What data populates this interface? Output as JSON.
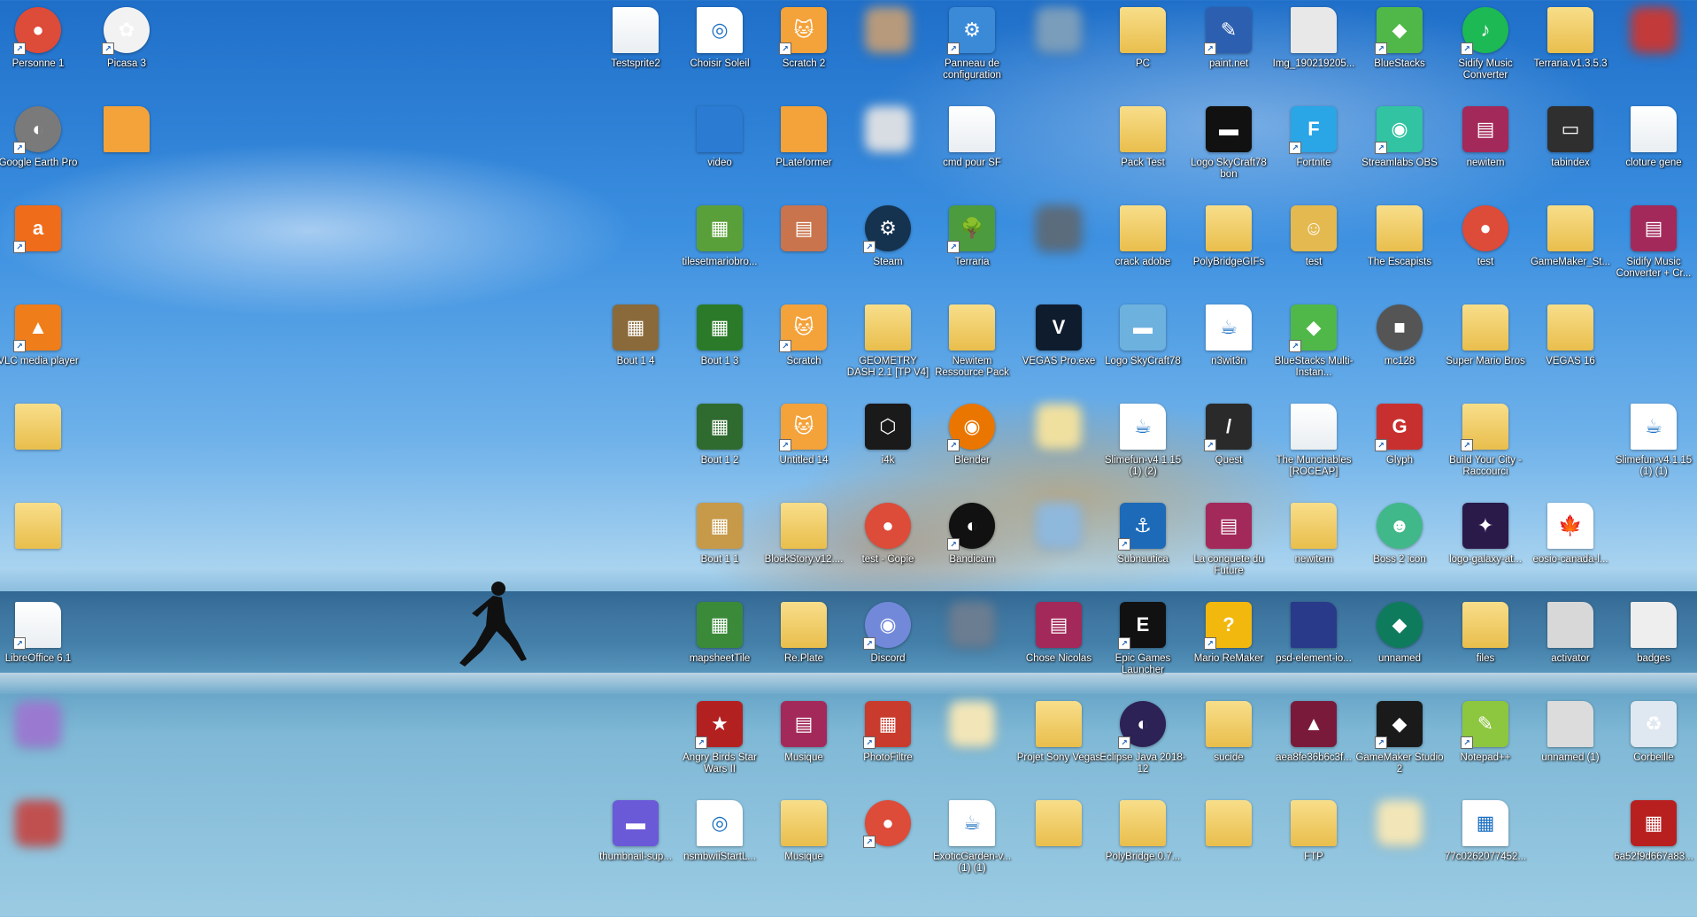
{
  "desktop": {
    "icons": [
      {
        "label": "Personne 1",
        "glyph": "●",
        "bg": "#dd4b39",
        "shape": "round",
        "shortcut": true
      },
      {
        "label": "Picasa 3",
        "glyph": "✿",
        "bg": "#f2f2f2",
        "shape": "round",
        "shortcut": true
      },
      {
        "label": "Testsprite2",
        "glyph": "",
        "bg": "",
        "shape": "file",
        "shortcut": false
      },
      {
        "label": "Choisir Soleil",
        "glyph": "◎",
        "bg": "#ffffff",
        "shape": "file",
        "shortcut": false
      },
      {
        "label": "Scratch 2",
        "glyph": "🐱",
        "bg": "#f4a23a",
        "shape": "",
        "shortcut": true
      },
      {
        "label": "",
        "glyph": "",
        "bg": "#b79a7c",
        "shape": "blur",
        "shortcut": false
      },
      {
        "label": "Panneau de configuration",
        "glyph": "⚙",
        "bg": "#3a8ad8",
        "shape": "",
        "shortcut": true
      },
      {
        "label": "",
        "glyph": "",
        "bg": "#7a9dbb",
        "shape": "blur",
        "shortcut": false
      },
      {
        "label": "PC",
        "glyph": "",
        "bg": "",
        "shape": "folder",
        "shortcut": false
      },
      {
        "label": "paint.net",
        "glyph": "✎",
        "bg": "#2d5fb0",
        "shape": "",
        "shortcut": true
      },
      {
        "label": "Img_190219205...",
        "glyph": "",
        "bg": "#e8e8e8",
        "shape": "file",
        "shortcut": false
      },
      {
        "label": "BlueStacks",
        "glyph": "◆",
        "bg": "#4fb848",
        "shape": "",
        "shortcut": true
      },
      {
        "label": "Sidify Music Converter",
        "glyph": "♪",
        "bg": "#1db954",
        "shape": "round",
        "shortcut": true
      },
      {
        "label": "Terraria.v1.3.5.3",
        "glyph": "",
        "bg": "",
        "shape": "folder",
        "shortcut": false
      },
      {
        "label": "",
        "glyph": "",
        "bg": "#c23a3a",
        "shape": "blur",
        "shortcut": false
      },
      {
        "label": "Google Earth Pro",
        "glyph": "◐",
        "bg": "#7a7a7a",
        "shape": "round",
        "shortcut": true
      },
      {
        "label": "",
        "glyph": "🐱",
        "bg": "#f4a23a",
        "shape": "file",
        "shortcut": false
      },
      {
        "label": "video",
        "glyph": "▶",
        "bg": "#2b7bd3",
        "shape": "file",
        "shortcut": false
      },
      {
        "label": "PLateformer",
        "glyph": "🐱",
        "bg": "#f4a23a",
        "shape": "file",
        "shortcut": false
      },
      {
        "label": "",
        "glyph": "",
        "bg": "#d8dde3",
        "shape": "blur",
        "shortcut": false
      },
      {
        "label": "cmd pour SF",
        "glyph": "",
        "bg": "",
        "shape": "file",
        "shortcut": false
      },
      {
        "label": "Pack Test",
        "glyph": "",
        "bg": "",
        "shape": "folder",
        "shortcut": false
      },
      {
        "label": "Logo SkyCraft78 bon",
        "glyph": "▬",
        "bg": "#111111",
        "shape": "",
        "shortcut": false
      },
      {
        "label": "Fortnite",
        "glyph": "F",
        "bg": "#2aa5e6",
        "shape": "",
        "shortcut": true
      },
      {
        "label": "Streamlabs OBS",
        "glyph": "◉",
        "bg": "#31c3a2",
        "shape": "",
        "shortcut": true
      },
      {
        "label": "newitem",
        "glyph": "▤",
        "bg": "#a3295a",
        "shape": "",
        "shortcut": false
      },
      {
        "label": "tabindex",
        "glyph": "▭",
        "bg": "#2f2f2f",
        "shape": "",
        "shortcut": false
      },
      {
        "label": "cloture gene",
        "glyph": "",
        "bg": "",
        "shape": "file",
        "shortcut": false
      },
      {
        "label": "",
        "glyph": "a",
        "bg": "#ef6c1a",
        "shape": "",
        "shortcut": true
      },
      {
        "label": "tilesetmariobro...",
        "glyph": "▦",
        "bg": "#5aa03a",
        "shape": "",
        "shortcut": false
      },
      {
        "label": "",
        "glyph": "▤",
        "bg": "#c9744d",
        "shape": "",
        "shortcut": false
      },
      {
        "label": "Steam",
        "glyph": "⚙",
        "bg": "#15324f",
        "shape": "round",
        "shortcut": true
      },
      {
        "label": "Terraria",
        "glyph": "🌳",
        "bg": "#4c9b3f",
        "shape": "",
        "shortcut": true
      },
      {
        "label": "",
        "glyph": "",
        "bg": "#5b6c7c",
        "shape": "blur",
        "shortcut": false
      },
      {
        "label": "crack adobe",
        "glyph": "",
        "bg": "",
        "shape": "folder",
        "shortcut": false
      },
      {
        "label": "PolyBridgeGIFs",
        "glyph": "",
        "bg": "",
        "shape": "folder",
        "shortcut": false
      },
      {
        "label": "test",
        "glyph": "☺",
        "bg": "#e4b94f",
        "shape": "",
        "shortcut": false
      },
      {
        "label": "The Escapists",
        "glyph": "",
        "bg": "",
        "shape": "folder",
        "shortcut": false
      },
      {
        "label": "test",
        "glyph": "●",
        "bg": "#dd4b39",
        "shape": "round",
        "shortcut": false
      },
      {
        "label": "GameMaker_St...",
        "glyph": "",
        "bg": "",
        "shape": "folder",
        "shortcut": false
      },
      {
        "label": "Sidify Music Converter + Cr...",
        "glyph": "▤",
        "bg": "#a3295a",
        "shape": "",
        "shortcut": false
      },
      {
        "label": "VLC media player",
        "glyph": "▲",
        "bg": "#ef7d1a",
        "shape": "",
        "shortcut": true
      },
      {
        "label": "Bout 1 4",
        "glyph": "▦",
        "bg": "#8a6a3a",
        "shape": "",
        "shortcut": false
      },
      {
        "label": "Bout 1 3",
        "glyph": "▦",
        "bg": "#2a7a2a",
        "shape": "",
        "shortcut": false
      },
      {
        "label": "Scratch",
        "glyph": "🐱",
        "bg": "#f4a23a",
        "shape": "",
        "shortcut": true
      },
      {
        "label": "GEOMETRY DASH 2.1 [TP V4]",
        "glyph": "",
        "bg": "",
        "shape": "folder",
        "shortcut": false
      },
      {
        "label": "Newitem Ressource Pack",
        "glyph": "",
        "bg": "",
        "shape": "folder",
        "shortcut": false
      },
      {
        "label": "VEGAS Pro.exe",
        "glyph": "V",
        "bg": "#0f1c2e",
        "shape": "",
        "shortcut": false
      },
      {
        "label": "Logo SkyCraft78",
        "glyph": "▬",
        "bg": "#6db2de",
        "shape": "",
        "shortcut": false
      },
      {
        "label": "n3wit3n",
        "glyph": "☕",
        "bg": "#ffffff",
        "shape": "file",
        "shortcut": false
      },
      {
        "label": "BlueStacks Multi-Instan...",
        "glyph": "◆",
        "bg": "#4fb848",
        "shape": "",
        "shortcut": true
      },
      {
        "label": "mc128",
        "glyph": "■",
        "bg": "#555555",
        "shape": "round",
        "shortcut": false
      },
      {
        "label": "Super Mario Bros",
        "glyph": "",
        "bg": "",
        "shape": "folder",
        "shortcut": false
      },
      {
        "label": "VEGAS 16",
        "glyph": "",
        "bg": "",
        "shape": "folder",
        "shortcut": false
      },
      {
        "label": "",
        "glyph": "",
        "bg": "",
        "shape": "folder",
        "shortcut": false
      },
      {
        "label": "Bout 1 2",
        "glyph": "▦",
        "bg": "#2f6a2f",
        "shape": "",
        "shortcut": false
      },
      {
        "label": "Untitled 14",
        "glyph": "🐱",
        "bg": "#f4a23a",
        "shape": "",
        "shortcut": true
      },
      {
        "label": "i4k",
        "glyph": "⬡",
        "bg": "#1a1a1a",
        "shape": "",
        "shortcut": false
      },
      {
        "label": "Blender",
        "glyph": "◉",
        "bg": "#ea7600",
        "shape": "round",
        "shortcut": true
      },
      {
        "label": "",
        "glyph": "",
        "bg": "#f0e0a0",
        "shape": "blur",
        "shortcut": false
      },
      {
        "label": "Slimefun-v4.1.15 (1) (2)",
        "glyph": "☕",
        "bg": "#ffffff",
        "shape": "file",
        "shortcut": false
      },
      {
        "label": "Quest",
        "glyph": "/",
        "bg": "#2a2a2a",
        "shape": "",
        "shortcut": true
      },
      {
        "label": "The Munchables [ROCEAP]",
        "glyph": "",
        "bg": "",
        "shape": "file",
        "shortcut": false
      },
      {
        "label": "Glyph",
        "glyph": "G",
        "bg": "#c8302f",
        "shape": "",
        "shortcut": true
      },
      {
        "label": "Build Your City - Raccourci",
        "glyph": "",
        "bg": "",
        "shape": "folder",
        "shortcut": true
      },
      {
        "label": "Slimefun-v4.1.15 (1) (1)",
        "glyph": "☕",
        "bg": "#ffffff",
        "shape": "file",
        "shortcut": false
      },
      {
        "label": "",
        "glyph": "",
        "bg": "",
        "shape": "folder",
        "shortcut": false
      },
      {
        "label": "Bout 1 1",
        "glyph": "▦",
        "bg": "#c79a4a",
        "shape": "",
        "shortcut": false
      },
      {
        "label": "BlockStory.v12....",
        "glyph": "",
        "bg": "",
        "shape": "folder",
        "shortcut": false
      },
      {
        "label": "test - Copie",
        "glyph": "●",
        "bg": "#dd4b39",
        "shape": "round",
        "shortcut": false
      },
      {
        "label": "Bandicam",
        "glyph": "◐",
        "bg": "#111111",
        "shape": "round",
        "shortcut": true
      },
      {
        "label": "",
        "glyph": "",
        "bg": "#8fb8dd",
        "shape": "blur",
        "shortcut": false
      },
      {
        "label": "Subnautica",
        "glyph": "⚓",
        "bg": "#1c6ab8",
        "shape": "",
        "shortcut": true
      },
      {
        "label": "La conquete du Future",
        "glyph": "▤",
        "bg": "#a3295a",
        "shape": "",
        "shortcut": false
      },
      {
        "label": "newitem",
        "glyph": "",
        "bg": "",
        "shape": "folder",
        "shortcut": false
      },
      {
        "label": "Boss 2 icon",
        "glyph": "☻",
        "bg": "#41b88a",
        "shape": "round",
        "shortcut": false
      },
      {
        "label": "logo-galaxy-at...",
        "glyph": "✦",
        "bg": "#2a1a4a",
        "shape": "",
        "shortcut": false
      },
      {
        "label": "eosio-canada-l...",
        "glyph": "🍁",
        "bg": "#ffffff",
        "shape": "file",
        "shortcut": false
      },
      {
        "label": "LibreOffice 6.1",
        "glyph": "",
        "bg": "",
        "shape": "file",
        "shortcut": true
      },
      {
        "label": "mapsheetTile",
        "glyph": "▦",
        "bg": "#3a8a3a",
        "shape": "",
        "shortcut": false
      },
      {
        "label": "Re.Plate",
        "glyph": "",
        "bg": "",
        "shape": "folder",
        "shortcut": false
      },
      {
        "label": "Discord",
        "glyph": "◉",
        "bg": "#7289da",
        "shape": "round",
        "shortcut": true
      },
      {
        "label": "",
        "glyph": "",
        "bg": "#6b7d91",
        "shape": "blur",
        "shortcut": false
      },
      {
        "label": "Chose Nicolas",
        "glyph": "▤",
        "bg": "#a3295a",
        "shape": "",
        "shortcut": false
      },
      {
        "label": "Epic Games Launcher",
        "glyph": "E",
        "bg": "#111111",
        "shape": "",
        "shortcut": true
      },
      {
        "label": "Mario ReMaker",
        "glyph": "?",
        "bg": "#f2b80e",
        "shape": "",
        "shortcut": true
      },
      {
        "label": "psd-element-io...",
        "glyph": "✦",
        "bg": "#2a3a8a",
        "shape": "file",
        "shortcut": false
      },
      {
        "label": "unnamed",
        "glyph": "◆",
        "bg": "#0e7c5c",
        "shape": "round",
        "shortcut": false
      },
      {
        "label": "files",
        "glyph": "",
        "bg": "",
        "shape": "folder",
        "shortcut": false
      },
      {
        "label": "activator",
        "glyph": "⚙",
        "bg": "#d8d8d8",
        "shape": "file",
        "shortcut": false
      },
      {
        "label": "badges",
        "glyph": "▦",
        "bg": "#eeeeee",
        "shape": "file",
        "shortcut": false
      },
      {
        "label": "",
        "glyph": "",
        "bg": "#9a7ad0",
        "shape": "blur",
        "shortcut": false
      },
      {
        "label": "Angry Birds Star Wars II",
        "glyph": "★",
        "bg": "#b32020",
        "shape": "",
        "shortcut": true
      },
      {
        "label": "Musique",
        "glyph": "▤",
        "bg": "#a3295a",
        "shape": "",
        "shortcut": false
      },
      {
        "label": "PhotoFiltre",
        "glyph": "▦",
        "bg": "#c83b2d",
        "shape": "",
        "shortcut": true
      },
      {
        "label": "",
        "glyph": "",
        "bg": "#f2e6b8",
        "shape": "blur",
        "shortcut": false
      },
      {
        "label": "Projet Sony Vegas",
        "glyph": "",
        "bg": "",
        "shape": "folder",
        "shortcut": false
      },
      {
        "label": "Eclipse Java 2018-12",
        "glyph": "◐",
        "bg": "#2c2255",
        "shape": "round",
        "shortcut": true
      },
      {
        "label": "sucide",
        "glyph": "",
        "bg": "",
        "shape": "folder",
        "shortcut": false
      },
      {
        "label": "aea8fe36b6c3f...",
        "glyph": "▲",
        "bg": "#7a1a3a",
        "shape": "",
        "shortcut": false
      },
      {
        "label": "GameMaker Studio 2",
        "glyph": "◆",
        "bg": "#1a1a1a",
        "shape": "",
        "shortcut": true
      },
      {
        "label": "Notepad++",
        "glyph": "✎",
        "bg": "#8dc63f",
        "shape": "",
        "shortcut": true
      },
      {
        "label": "unnamed (1)",
        "glyph": "▦",
        "bg": "#dcdcdc",
        "shape": "file",
        "shortcut": false
      },
      {
        "label": "Corbeille",
        "glyph": "♻",
        "bg": "#dfe8f0",
        "shape": "",
        "shortcut": false
      },
      {
        "label": "",
        "glyph": "",
        "bg": "#c05050",
        "shape": "blur",
        "shortcut": false
      },
      {
        "label": "thumbnail-sup...",
        "glyph": "▬",
        "bg": "#6a5ad8",
        "shape": "",
        "shortcut": false
      },
      {
        "label": "nsmbwiiStartL...",
        "glyph": "◎",
        "bg": "#ffffff",
        "shape": "file",
        "shortcut": false
      },
      {
        "label": "Musique",
        "glyph": "",
        "bg": "",
        "shape": "folder",
        "shortcut": false
      },
      {
        "label": "",
        "glyph": "●",
        "bg": "#dd4b39",
        "shape": "round",
        "shortcut": true
      },
      {
        "label": "ExoticGarden-v... (1) (1)",
        "glyph": "☕",
        "bg": "#ffffff",
        "shape": "file",
        "shortcut": false
      },
      {
        "label": "",
        "glyph": "",
        "bg": "",
        "shape": "folder",
        "shortcut": false
      },
      {
        "label": "PolyBridge.0.7...",
        "glyph": "",
        "bg": "",
        "shape": "folder",
        "shortcut": false
      },
      {
        "label": "",
        "glyph": "",
        "bg": "",
        "shape": "folder",
        "shortcut": false
      },
      {
        "label": "FTP",
        "glyph": "",
        "bg": "",
        "shape": "folder",
        "shortcut": false
      },
      {
        "label": "",
        "glyph": "",
        "bg": "#f2e6b8",
        "shape": "blur",
        "shortcut": false
      },
      {
        "label": "77c0262077452...",
        "glyph": "▦",
        "bg": "#ffffff",
        "shape": "file",
        "shortcut": false
      },
      {
        "label": "6a52f9d667a83...",
        "glyph": "▦",
        "bg": "#b82020",
        "shape": "",
        "shortcut": false
      }
    ]
  }
}
